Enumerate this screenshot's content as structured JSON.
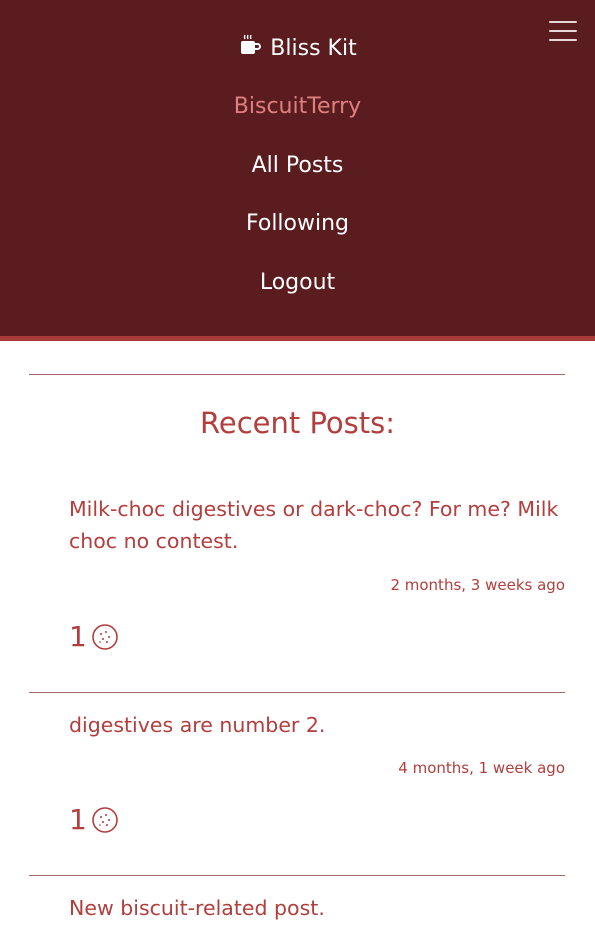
{
  "nav": {
    "brand": "Bliss Kit",
    "brand_icon": "coffee-mug-icon",
    "user": "BiscuitTerry",
    "links": [
      "All Posts",
      "Following",
      "Logout"
    ],
    "menu_icon": "hamburger-menu-icon"
  },
  "main": {
    "heading": "Recent Posts:",
    "posts": [
      {
        "title": "Milk-choc digestives or dark-choc? For me? Milk choc no contest.",
        "time": "2 months, 3 weeks ago",
        "likes": "1"
      },
      {
        "title": "digestives are number 2.",
        "time": "4 months, 1 week ago",
        "likes": "1"
      },
      {
        "title": "New biscuit-related post."
      }
    ]
  },
  "colors": {
    "nav_bg": "#5a1c1e",
    "accent": "#b23e3e",
    "active_link": "#e07f80"
  }
}
